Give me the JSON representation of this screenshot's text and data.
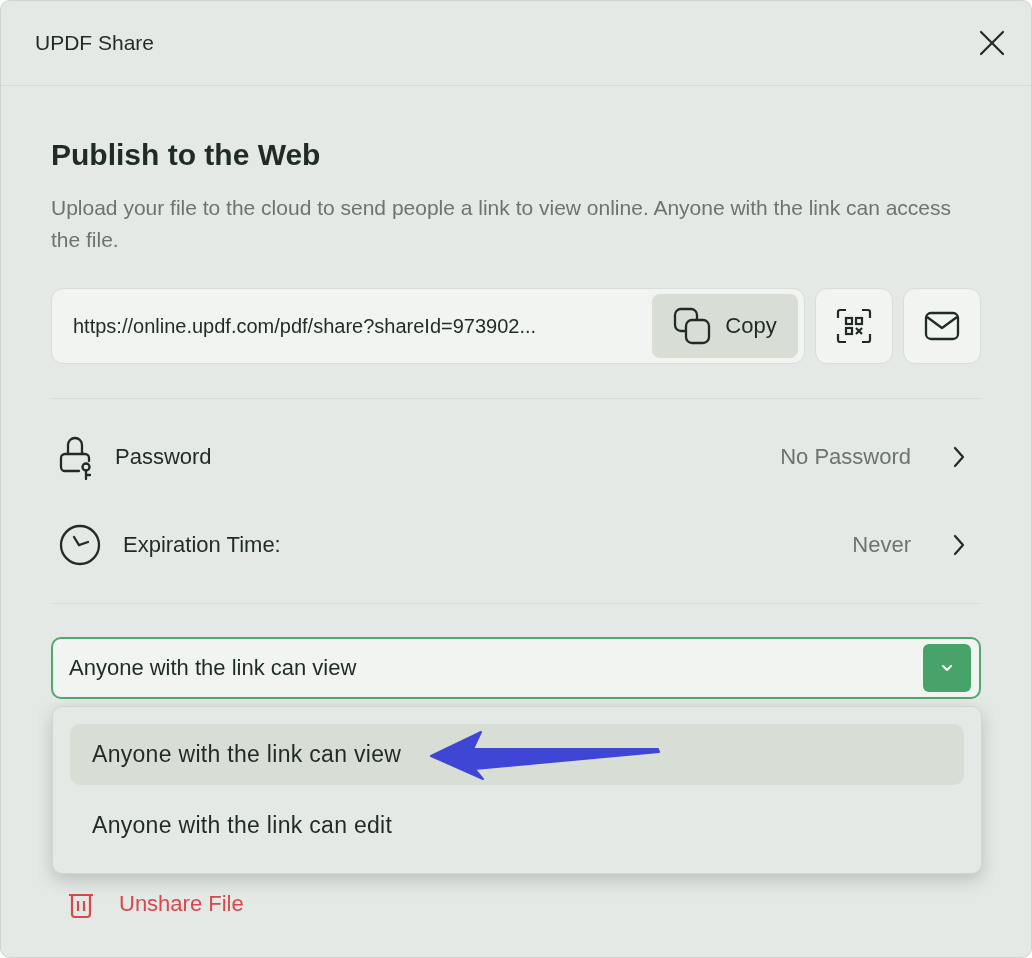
{
  "window": {
    "title": "UPDF Share"
  },
  "heading": "Publish to the Web",
  "description": "Upload your file to the cloud to send people a link to view online. Anyone with the link can access the file.",
  "share_link": {
    "value": "https://online.updf.com/pdf/share?shareId=973902...",
    "copy_label": "Copy"
  },
  "settings": [
    {
      "kind": "password",
      "label": "Password",
      "value": "No Password"
    },
    {
      "kind": "expiration",
      "label": "Expiration Time:",
      "value": "Never"
    }
  ],
  "permission": {
    "value": "Anyone with the link can view",
    "expanded": true,
    "options": [
      {
        "label": "Anyone with the link can view",
        "selected": true
      },
      {
        "label": "Anyone with the link can edit",
        "selected": false
      }
    ]
  },
  "unshare": {
    "label": "Unshare File"
  }
}
